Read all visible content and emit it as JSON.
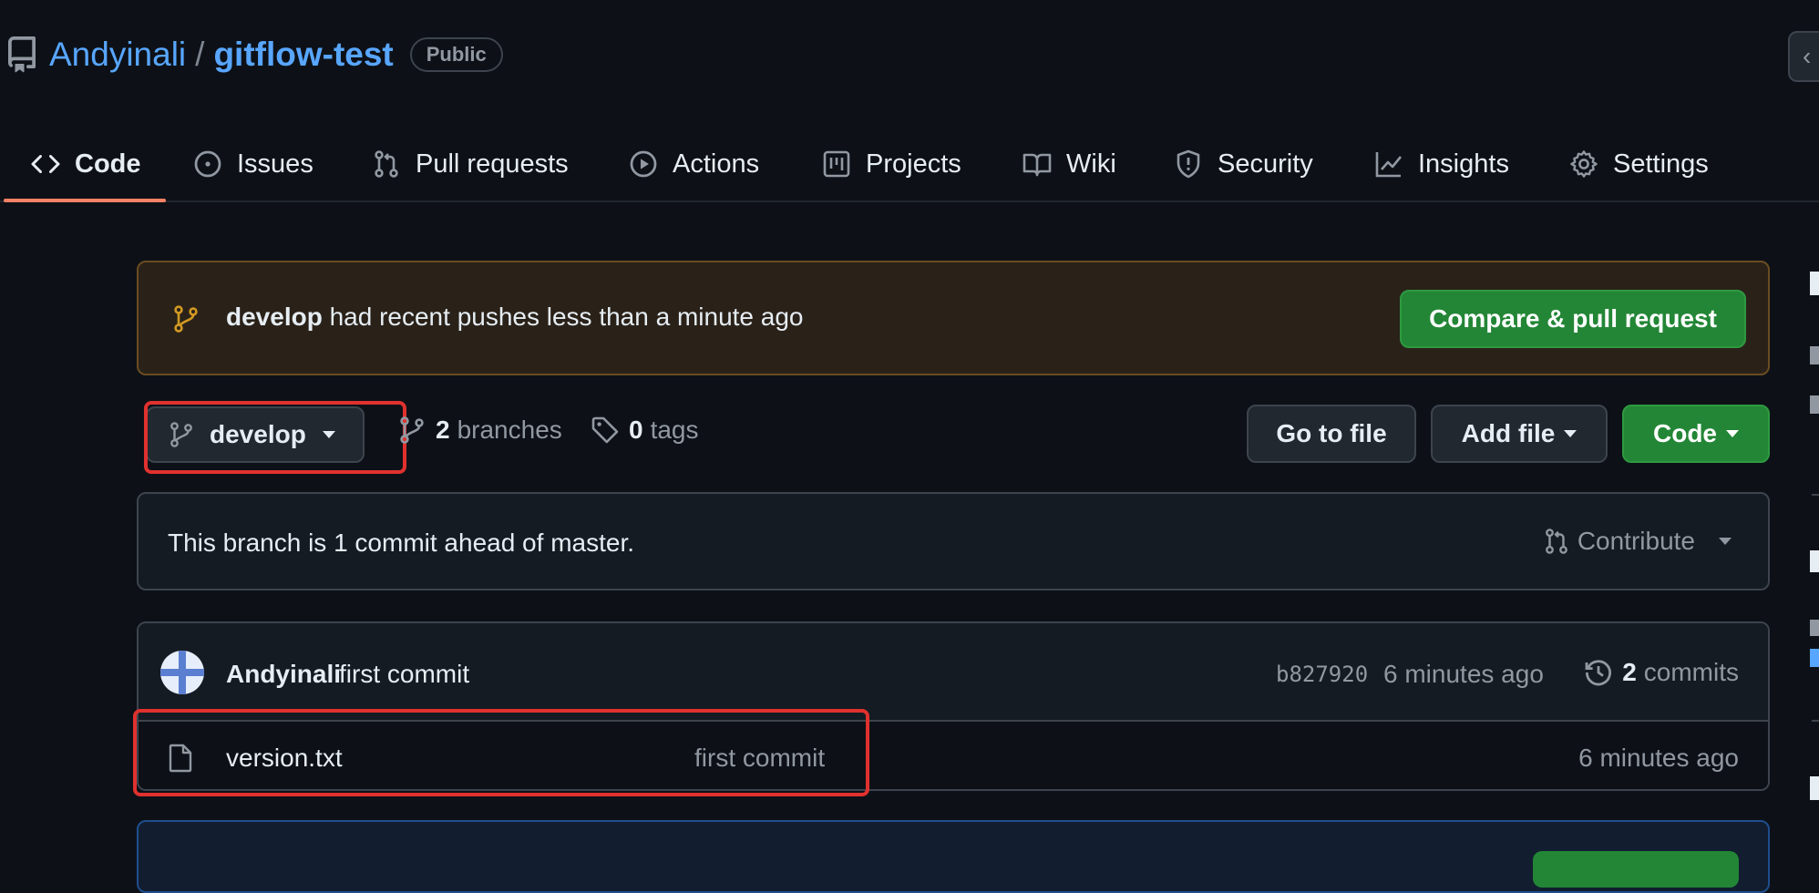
{
  "header": {
    "owner": "Andyinali",
    "separator": "/",
    "repo_name": "gitflow-test",
    "visibility": "Public"
  },
  "tabs": [
    {
      "label": "Code",
      "icon": "code-icon",
      "active": true
    },
    {
      "label": "Issues",
      "icon": "issue-icon"
    },
    {
      "label": "Pull requests",
      "icon": "pull-request-icon"
    },
    {
      "label": "Actions",
      "icon": "play-icon"
    },
    {
      "label": "Projects",
      "icon": "project-icon"
    },
    {
      "label": "Wiki",
      "icon": "book-icon"
    },
    {
      "label": "Security",
      "icon": "shield-icon"
    },
    {
      "label": "Insights",
      "icon": "graph-icon"
    },
    {
      "label": "Settings",
      "icon": "gear-icon"
    }
  ],
  "banner": {
    "branch": "develop",
    "message": " had recent pushes less than a minute ago",
    "button": "Compare & pull request"
  },
  "branch_bar": {
    "current_branch": "develop",
    "branches_count": "2",
    "branches_label": "branches",
    "tags_count": "0",
    "tags_label": "tags",
    "go_to_file": "Go to file",
    "add_file": "Add file",
    "code": "Code"
  },
  "ahead": {
    "text": "This branch is 1 commit ahead of master.",
    "contribute": "Contribute"
  },
  "latest_commit": {
    "author": "Andyinali",
    "message": "first commit",
    "sha": "b827920",
    "time": "6 minutes ago",
    "commits_count": "2",
    "commits_label": "commits"
  },
  "files": [
    {
      "name": "version.txt",
      "message": "first commit",
      "time": "6 minutes ago"
    }
  ],
  "colors": {
    "accent_blue": "#58a6ff",
    "tab_underline": "#f78166",
    "primary_green": "#238636",
    "highlight_red": "#e0312e",
    "banner_icon": "#d29922"
  }
}
